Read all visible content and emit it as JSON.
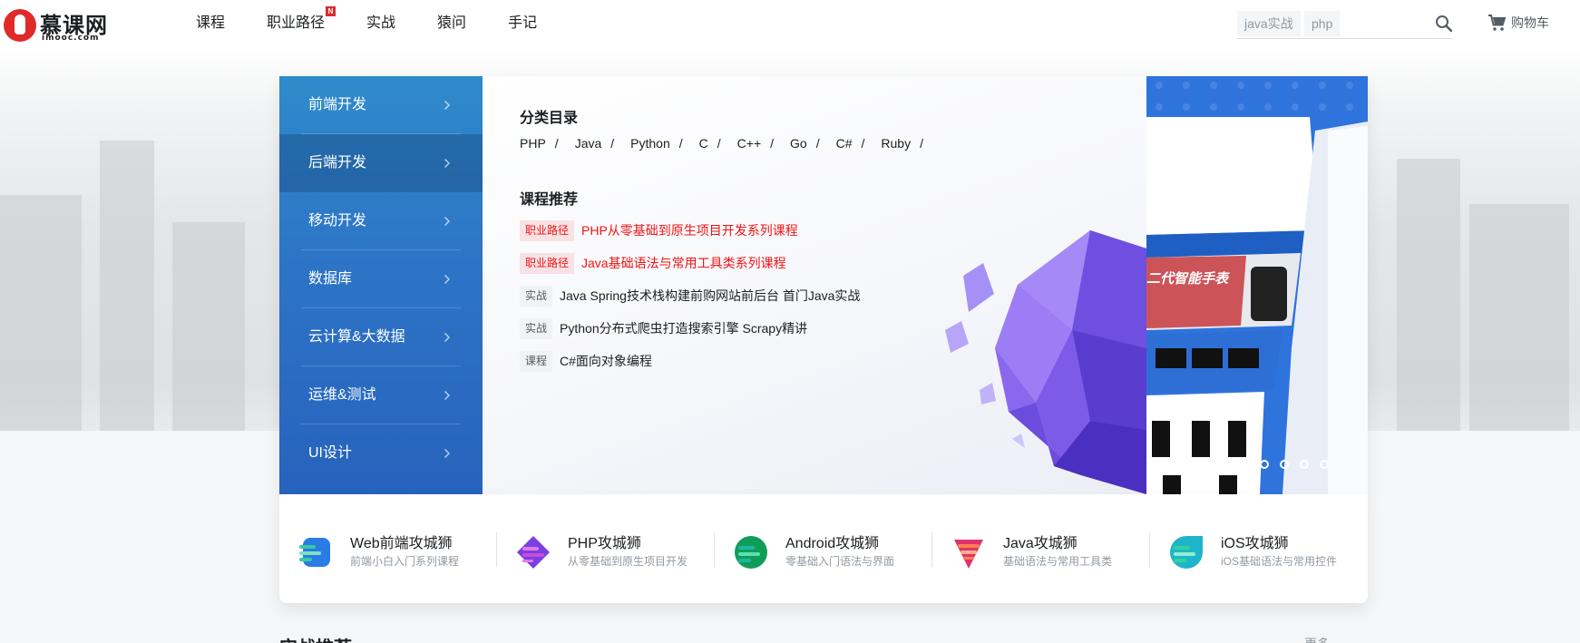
{
  "header": {
    "logo_text": "慕课网",
    "logo_sub": "imooc.com",
    "nav": [
      {
        "label": "课程",
        "badge": ""
      },
      {
        "label": "职业路径",
        "badge": "N"
      },
      {
        "label": "实战",
        "badge": ""
      },
      {
        "label": "猿问",
        "badge": ""
      },
      {
        "label": "手记",
        "badge": ""
      }
    ],
    "search": {
      "tags": [
        "java实战",
        "php"
      ],
      "placeholder": ""
    },
    "cart_label": "购物车"
  },
  "menu": {
    "items": [
      {
        "label": "前端开发",
        "active": false
      },
      {
        "label": "后端开发",
        "active": true
      },
      {
        "label": "移动开发",
        "active": false
      },
      {
        "label": "数据库",
        "active": false
      },
      {
        "label": "云计算&大数据",
        "active": false
      },
      {
        "label": "运维&测试",
        "active": false
      },
      {
        "label": "UI设计",
        "active": false
      }
    ]
  },
  "panel": {
    "category_title": "分类目录",
    "categories": [
      "PHP",
      "Java",
      "Python",
      "C",
      "C++",
      "Go",
      "C#",
      "Ruby"
    ],
    "separator": "/",
    "recommend_title": "课程推荐",
    "recommendations": [
      {
        "tag": "职业路径",
        "title": "PHP从零基础到原生项目开发系列课程",
        "highlight": true
      },
      {
        "tag": "职业路径",
        "title": "Java基础语法与常用工具类系列课程",
        "highlight": true
      },
      {
        "tag": "实战",
        "title": "Java Spring技术栈构建前购网站前后台 首门Java实战",
        "highlight": false
      },
      {
        "tag": "实战",
        "title": "Python分布式爬虫打造搜索引擎 Scrapy精讲",
        "highlight": false
      },
      {
        "tag": "课程",
        "title": "C#面向对象编程",
        "highlight": false
      }
    ]
  },
  "slider": {
    "banner_text": "二代智能手表",
    "slide_count": 5,
    "active_index": 0
  },
  "paths": [
    {
      "title": "Web前端攻城狮",
      "desc": "前端小白入门系列课程",
      "color": "#2b7be4",
      "accent": "#38c9a6"
    },
    {
      "title": "PHP攻城狮",
      "desc": "从零基础到原生项目开发",
      "color": "#7b3fe4",
      "accent": "#c94cd8"
    },
    {
      "title": "Android攻城狮",
      "desc": "零基础入门语法与界面",
      "color": "#0f9d58",
      "accent": "#1fb5a5"
    },
    {
      "title": "Java攻城狮",
      "desc": "基础语法与常用工具类",
      "color": "#e0336b",
      "accent": "#ff7f50"
    },
    {
      "title": "iOS攻城狮",
      "desc": "iOS基础语法与常用控件",
      "color": "#1fb5c9",
      "accent": "#33d1a0"
    }
  ],
  "section": {
    "title": "实战推荐",
    "more": "更多"
  },
  "colors": {
    "brand_red": "#e02a2a",
    "menu_blue": "#2d74c6",
    "highlight_red": "#f01414"
  }
}
